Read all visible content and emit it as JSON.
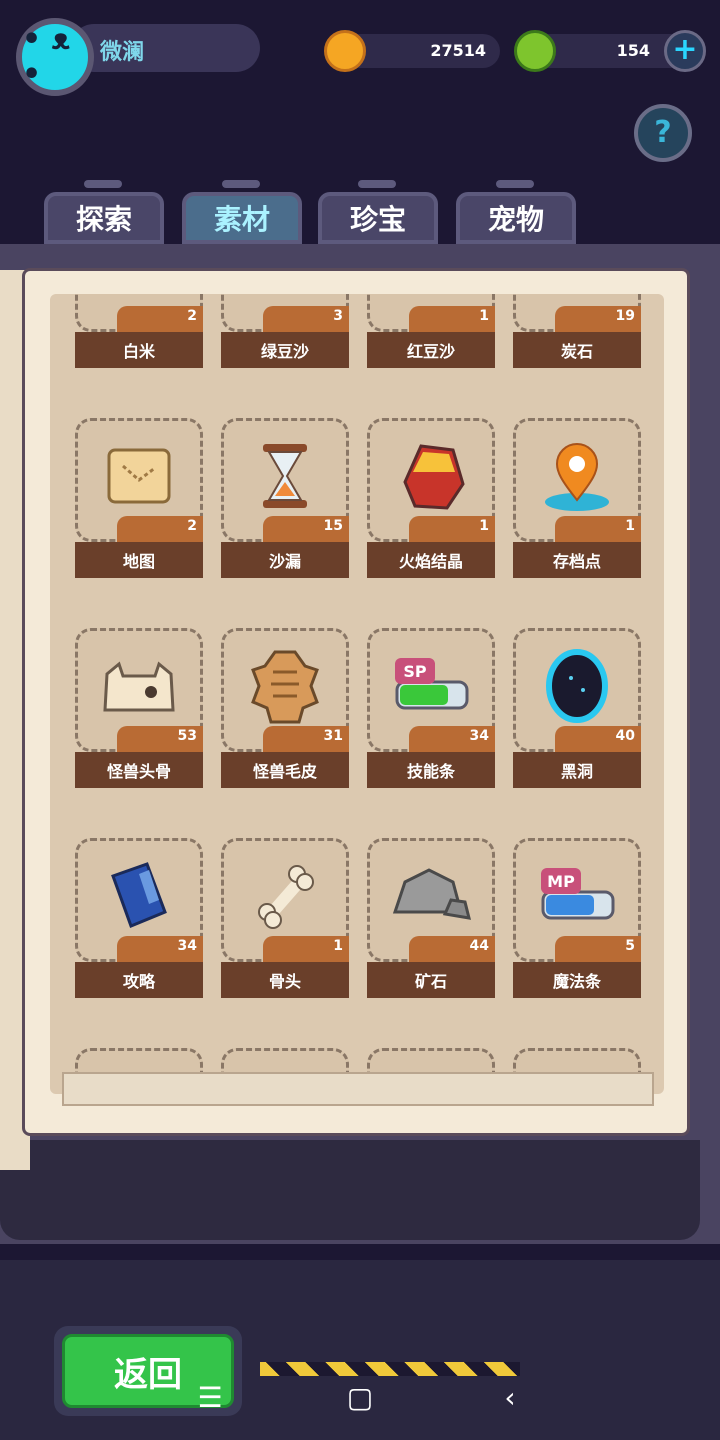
{
  "player": {
    "name": "微澜"
  },
  "resources": [
    {
      "name": "coin",
      "value": "27514",
      "color": "#f5a623"
    },
    {
      "name": "gem",
      "value": "154",
      "color": "#7ec52d"
    }
  ],
  "plus_symbol": "+",
  "help_symbol": "?",
  "tabs": [
    {
      "label": "探索"
    },
    {
      "label": "素材"
    },
    {
      "label": "珍宝"
    },
    {
      "label": "宠物"
    }
  ],
  "active_tab": "素材",
  "items": [
    {
      "label": "白米",
      "count": "2"
    },
    {
      "label": "绿豆沙",
      "count": "3"
    },
    {
      "label": "红豆沙",
      "count": "1"
    },
    {
      "label": "炭石",
      "count": "19"
    },
    {
      "label": "地图",
      "count": "2"
    },
    {
      "label": "沙漏",
      "count": "15"
    },
    {
      "label": "火焰结晶",
      "count": "1"
    },
    {
      "label": "存档点",
      "count": "1"
    },
    {
      "label": "怪兽头骨",
      "count": "53"
    },
    {
      "label": "怪兽毛皮",
      "count": "31"
    },
    {
      "label": "技能条",
      "count": "34"
    },
    {
      "label": "黑洞",
      "count": "40"
    },
    {
      "label": "攻略",
      "count": "34"
    },
    {
      "label": "骨头",
      "count": "1"
    },
    {
      "label": "矿石",
      "count": "44"
    },
    {
      "label": "魔法条",
      "count": "5"
    }
  ],
  "icon_text": {
    "sp": "SP",
    "mp": "MP"
  },
  "back_button": {
    "label": "返回"
  },
  "navbar": {
    "menu": "☰",
    "home": "▢",
    "back": "‹"
  }
}
